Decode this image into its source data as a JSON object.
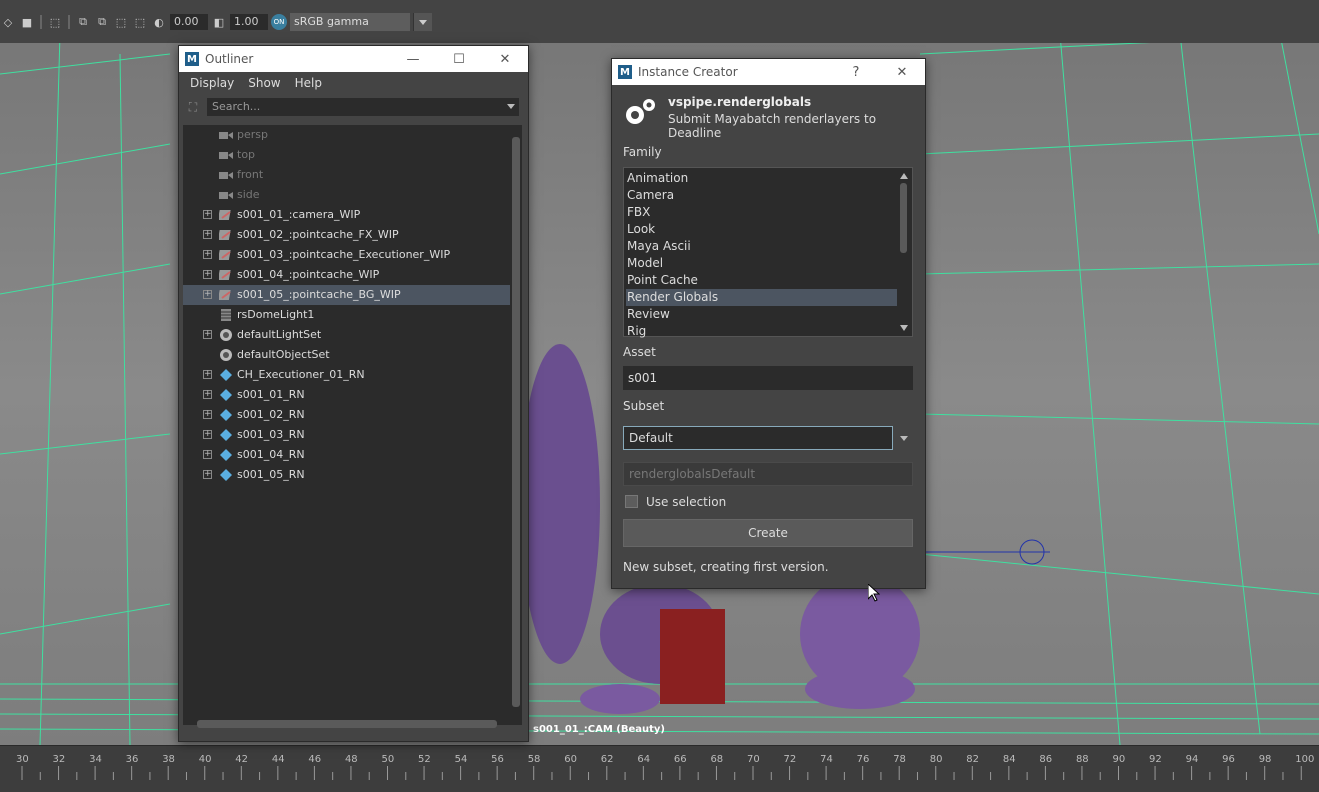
{
  "toolbar": {
    "exposure": "0.00",
    "gamma": "1.00",
    "colorspace": "sRGB gamma",
    "icons": [
      "select-icon",
      "lasso-icon",
      "paint-icon",
      "move-icon",
      "rotate-icon",
      "scale-icon",
      "exposure-icon",
      "gamma-icon",
      "colorspace-icon"
    ]
  },
  "viewport": {
    "camera_label": "s001_01_:CAM (Beauty)"
  },
  "timeline": {
    "ticks": [
      "30",
      "32",
      "34",
      "36",
      "38",
      "40",
      "42",
      "44",
      "46",
      "48",
      "50",
      "52",
      "54",
      "56",
      "58",
      "60",
      "62",
      "64",
      "66",
      "68",
      "70",
      "72",
      "74",
      "76",
      "78",
      "80",
      "82",
      "84",
      "86",
      "88",
      "90",
      "92",
      "94",
      "96",
      "98",
      "100"
    ]
  },
  "outliner": {
    "title": "Outliner",
    "menu": [
      "Display",
      "Show",
      "Help"
    ],
    "search_placeholder": "Search...",
    "items": [
      {
        "label": "persp",
        "icon": "camera-icon",
        "dim": true,
        "expand": false
      },
      {
        "label": "top",
        "icon": "camera-icon",
        "dim": true,
        "expand": false
      },
      {
        "label": "front",
        "icon": "camera-icon",
        "dim": true,
        "expand": false
      },
      {
        "label": "side",
        "icon": "camera-icon",
        "dim": true,
        "expand": false
      },
      {
        "label": "s001_01_:camera_WIP",
        "icon": "reference-icon",
        "dim": false,
        "expand": true
      },
      {
        "label": "s001_02_:pointcache_FX_WIP",
        "icon": "reference-icon",
        "dim": false,
        "expand": true
      },
      {
        "label": "s001_03_:pointcache_Executioner_WIP",
        "icon": "reference-icon",
        "dim": false,
        "expand": true
      },
      {
        "label": "s001_04_:pointcache_WIP",
        "icon": "reference-icon",
        "dim": false,
        "expand": true
      },
      {
        "label": "s001_05_:pointcache_BG_WIP",
        "icon": "reference-icon",
        "dim": false,
        "expand": true,
        "selected": true
      },
      {
        "label": "rsDomeLight1",
        "icon": "dome-light-icon",
        "dim": false,
        "expand": false
      },
      {
        "label": "defaultLightSet",
        "icon": "set-icon",
        "dim": false,
        "expand": true
      },
      {
        "label": "defaultObjectSet",
        "icon": "set-icon",
        "dim": false,
        "expand": false
      },
      {
        "label": "CH_Executioner_01_RN",
        "icon": "reference-node-icon",
        "dim": false,
        "expand": true
      },
      {
        "label": "s001_01_RN",
        "icon": "reference-node-icon",
        "dim": false,
        "expand": true
      },
      {
        "label": "s001_02_RN",
        "icon": "reference-node-icon",
        "dim": false,
        "expand": true
      },
      {
        "label": "s001_03_RN",
        "icon": "reference-node-icon",
        "dim": false,
        "expand": true
      },
      {
        "label": "s001_04_RN",
        "icon": "reference-node-icon",
        "dim": false,
        "expand": true
      },
      {
        "label": "s001_05_RN",
        "icon": "reference-node-icon",
        "dim": false,
        "expand": true
      }
    ]
  },
  "creator": {
    "title": "Instance Creator",
    "help": "?",
    "plugin_name": "vspipe.renderglobals",
    "plugin_desc": "Submit Mayabatch renderlayers to Deadline",
    "family_label": "Family",
    "families": [
      "Animation",
      "Camera",
      "FBX",
      "Look",
      "Maya Ascii",
      "Model",
      "Point Cache",
      "Render Globals",
      "Review",
      "Rig"
    ],
    "selected_family": "Render Globals",
    "asset_label": "Asset",
    "asset_value": "s001",
    "subset_label": "Subset",
    "subset_value": "Default",
    "subset_result": "renderglobalsDefault",
    "use_selection_label": "Use selection",
    "use_selection_checked": false,
    "create_label": "Create",
    "status": "New subset, creating first version."
  }
}
